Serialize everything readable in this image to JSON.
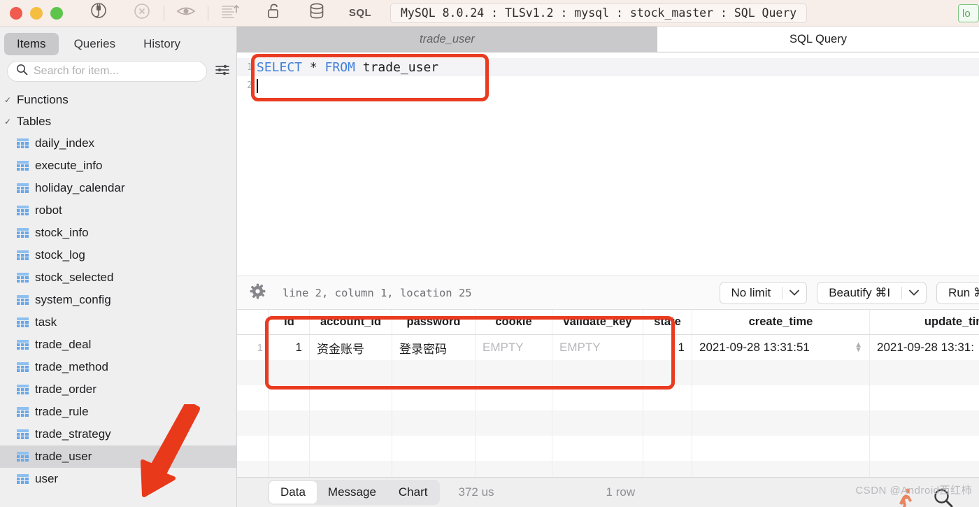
{
  "titlebar": {
    "window_title": "MySQL 8.0.24 : TLSv1.2 : mysql : stock_master : SQL Query",
    "sql_label": "SQL",
    "edge_chip": "lo",
    "icons": [
      {
        "name": "connect-plug-icon"
      },
      {
        "name": "disconnect-close-icon"
      },
      {
        "name": "preview-eye-icon"
      },
      {
        "name": "sort-lines-icon"
      },
      {
        "name": "unlock-padlock-icon"
      },
      {
        "name": "database-icon"
      }
    ]
  },
  "sidebar": {
    "tabs": [
      {
        "label": "Items",
        "active": true
      },
      {
        "label": "Queries",
        "active": false
      },
      {
        "label": "History",
        "active": false
      }
    ],
    "search": {
      "value": "",
      "placeholder": "Search for item..."
    },
    "groups": [
      {
        "label": "Functions",
        "expanded": true
      },
      {
        "label": "Tables",
        "expanded": true
      }
    ],
    "tables": [
      {
        "label": "daily_index",
        "selected": false
      },
      {
        "label": "execute_info",
        "selected": false
      },
      {
        "label": "holiday_calendar",
        "selected": false
      },
      {
        "label": "robot",
        "selected": false
      },
      {
        "label": "stock_info",
        "selected": false
      },
      {
        "label": "stock_log",
        "selected": false
      },
      {
        "label": "stock_selected",
        "selected": false
      },
      {
        "label": "system_config",
        "selected": false
      },
      {
        "label": "task",
        "selected": false
      },
      {
        "label": "trade_deal",
        "selected": false
      },
      {
        "label": "trade_method",
        "selected": false
      },
      {
        "label": "trade_order",
        "selected": false
      },
      {
        "label": "trade_rule",
        "selected": false
      },
      {
        "label": "trade_strategy",
        "selected": false
      },
      {
        "label": "trade_user",
        "selected": true
      },
      {
        "label": "user",
        "selected": false
      }
    ]
  },
  "editor_tabs": [
    {
      "label": "trade_user",
      "active": false
    },
    {
      "label": "SQL Query",
      "active": true
    }
  ],
  "editor": {
    "lines": [
      {
        "number": "1",
        "keyword1": "SELECT",
        "star": " * ",
        "keyword2": "FROM",
        "rest": " trade_user"
      },
      {
        "number": "2",
        "text": ""
      }
    ]
  },
  "query_toolbar": {
    "status": "line 2, column 1, location 25",
    "limit_button": "No limit",
    "beautify_button": "Beautify ⌘I",
    "run_button": "Run ⌘"
  },
  "result_grid": {
    "columns": [
      "id",
      "account_id",
      "password",
      "cookie",
      "validate_key",
      "state",
      "create_time",
      "update_time"
    ],
    "rows": [
      {
        "num": "1",
        "id": "1",
        "account_id": "资金账号",
        "password": "登录密码",
        "cookie": "EMPTY",
        "validate_key": "EMPTY",
        "state": "1",
        "create_time": "2021-09-28 13:31:51",
        "update_time": "2021-09-28 13:31:"
      }
    ]
  },
  "bottom_bar": {
    "tabs": [
      {
        "label": "Data",
        "active": true
      },
      {
        "label": "Message",
        "active": false
      },
      {
        "label": "Chart",
        "active": false
      }
    ],
    "duration": "372 us",
    "row_count": "1 row"
  },
  "watermark": "CSDN @Android西红柿",
  "colors": {
    "annotation_red": "#ea3b21",
    "sql_keyword_blue": "#3f7fd8",
    "table_icon_blue": "#6aa8e8",
    "titlebar_bg": "#f7eeea"
  }
}
